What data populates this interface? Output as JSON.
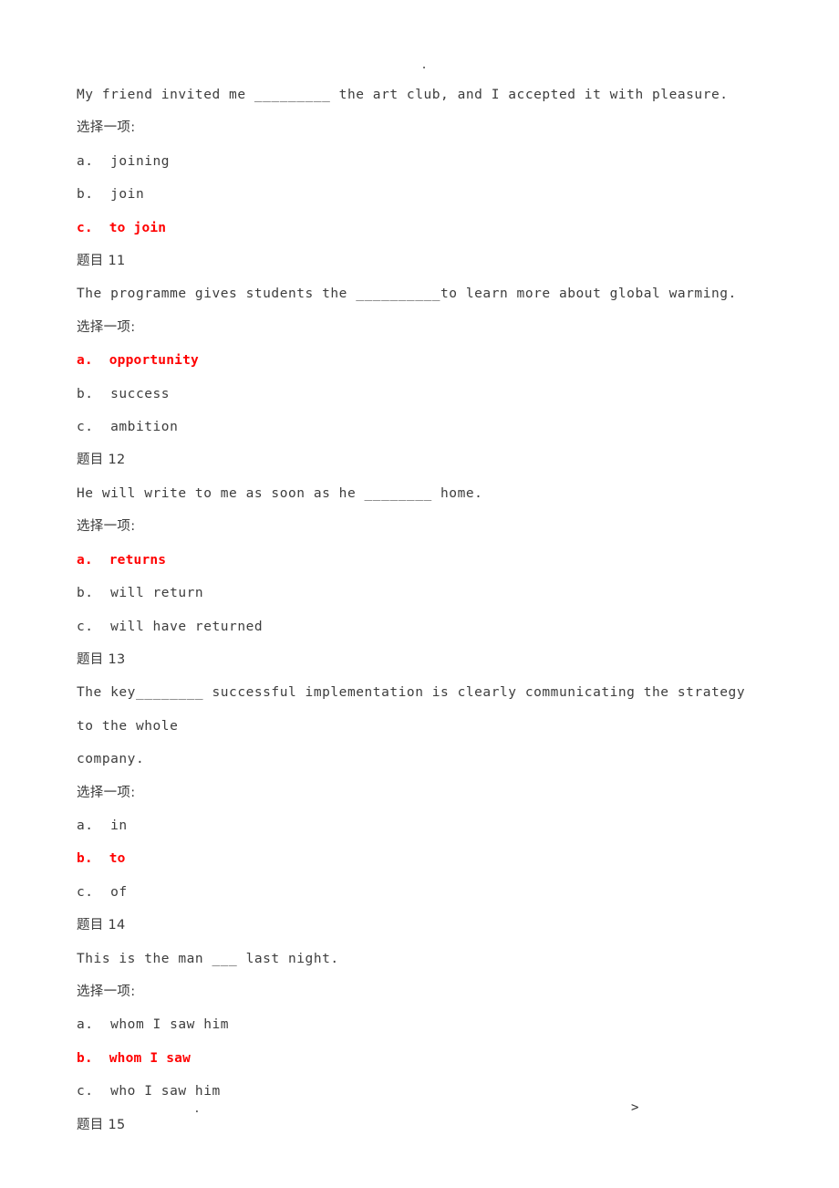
{
  "page": {
    "header_mark": ".",
    "footer_mark_left": ".",
    "footer_mark_right": ">"
  },
  "labels": {
    "choose_one": "选择一项:"
  },
  "blocks": [
    {
      "id": "q10-tail",
      "heading": null,
      "stem_lines": [
        "My friend invited me _________ the art club, and I accepted it with pleasure."
      ],
      "prompt": "选择一项:",
      "options": [
        {
          "label": "a.  joining",
          "correct": false
        },
        {
          "label": "b.  join",
          "correct": false
        },
        {
          "label": "c.  to join",
          "correct": true
        }
      ]
    },
    {
      "id": "q11",
      "heading": "题目 11",
      "stem_lines": [
        "The programme gives students the __________to learn more about global warming."
      ],
      "prompt": "选择一项:",
      "options": [
        {
          "label": "a.  opportunity",
          "correct": true
        },
        {
          "label": "b.  success",
          "correct": false
        },
        {
          "label": "c.  ambition",
          "correct": false
        }
      ]
    },
    {
      "id": "q12",
      "heading": "题目 12",
      "stem_lines": [
        "He will write to me as soon as he ________ home."
      ],
      "prompt": "选择一项:",
      "options": [
        {
          "label": "a.  returns",
          "correct": true
        },
        {
          "label": "b.  will return",
          "correct": false
        },
        {
          "label": "c.  will have returned",
          "correct": false
        }
      ]
    },
    {
      "id": "q13",
      "heading": "题目 13",
      "stem_lines": [
        "The key________ successful implementation is clearly communicating the strategy to the whole",
        "company."
      ],
      "prompt": "选择一项:",
      "options": [
        {
          "label": "a.  in",
          "correct": false
        },
        {
          "label": "b.  to",
          "correct": true
        },
        {
          "label": "c.  of",
          "correct": false
        }
      ]
    },
    {
      "id": "q14",
      "heading": "题目 14",
      "stem_lines": [
        "This is the man ___ last night."
      ],
      "prompt": "选择一项:",
      "options": [
        {
          "label": "a.  whom I saw him",
          "correct": false
        },
        {
          "label": "b.  whom I saw",
          "correct": true
        },
        {
          "label": "c.  who I saw him",
          "correct": false
        }
      ]
    },
    {
      "id": "q15",
      "heading": "题目 15",
      "stem_lines": [],
      "prompt": null,
      "options": []
    }
  ]
}
